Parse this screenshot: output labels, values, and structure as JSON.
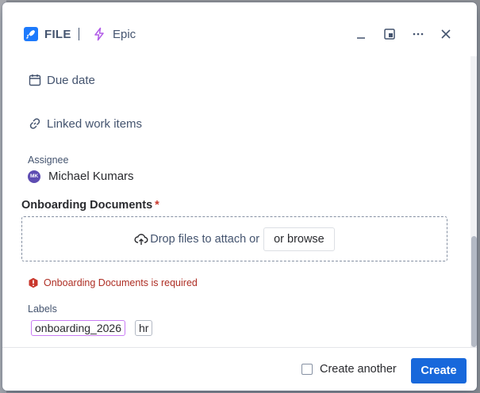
{
  "header": {
    "project_label": "FILE",
    "work_type_label": "Epic"
  },
  "fields": {
    "due_date_label": "Due date",
    "linked_items_label": "Linked work items",
    "assignee_label": "Assignee",
    "assignee_name": "Michael Kumars",
    "assignee_initials": "MK"
  },
  "attachments": {
    "title": "Onboarding Documents",
    "required_marker": "*",
    "drop_text": "Drop files to attach or",
    "browse_label": "or browse",
    "error_text": "Onboarding Documents is required"
  },
  "labels": {
    "title": "Labels",
    "items": [
      "onboarding_2026",
      "hr"
    ]
  },
  "footer": {
    "create_another_label": "Create another",
    "create_label": "Create"
  },
  "colors": {
    "primary": "#1868db",
    "error": "#ae2e24",
    "avatar": "#5e4db2",
    "epic_icon": "#a54800"
  }
}
